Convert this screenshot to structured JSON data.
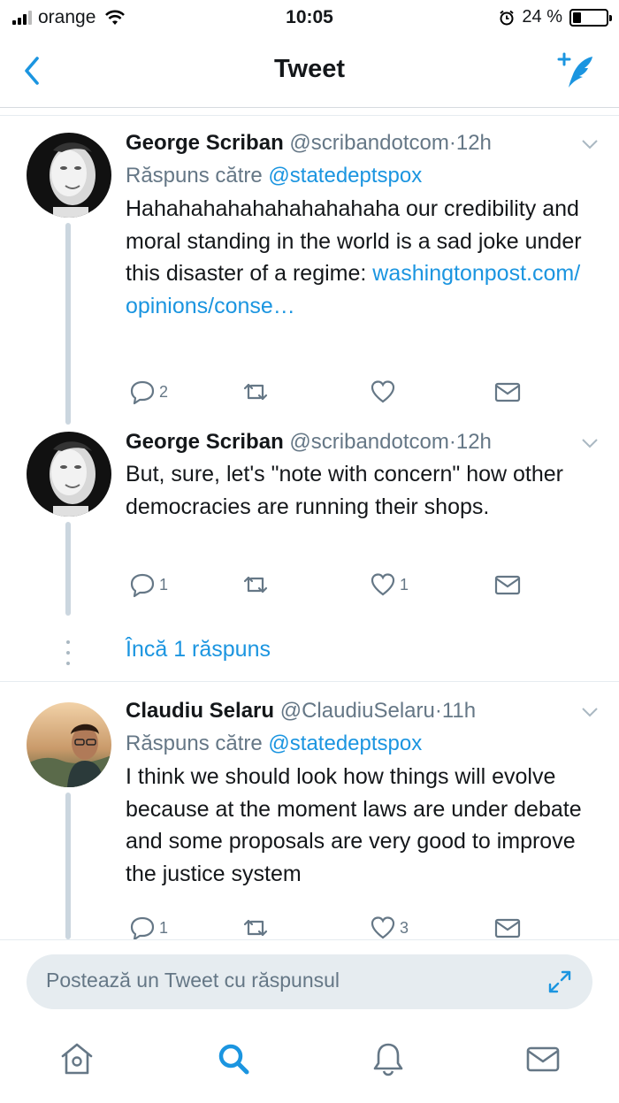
{
  "status_bar": {
    "carrier": "orange",
    "time": "10:05",
    "battery_percent": "24 %",
    "battery_level": 0.24
  },
  "nav": {
    "title": "Tweet",
    "back_icon": "chevron-left-icon",
    "compose_icon": "compose-tweet-icon"
  },
  "tweets": [
    {
      "name": "George Scriban",
      "handle": "@scribandotcom",
      "dot": "·",
      "time": "12h",
      "reply_prefix": "Răspuns către",
      "reply_mention": "@statedeptspox",
      "text": "Hahahahahahahahahahaha our credibility and moral standing in the world is a sad joke under this disaster of a regime: ",
      "link": "washingtonpost.com/ opinions/conse…",
      "replies": "2",
      "retweets": "",
      "likes": "",
      "avatar_icon": "avatar-photo"
    },
    {
      "name": "George Scriban",
      "handle": "@scribandotcom",
      "dot": "·",
      "time": "12h",
      "text": "But, sure, let's \"note with concern\" how other democracies are running their shops.",
      "replies": "1",
      "retweets": "",
      "likes": "1",
      "avatar_icon": "avatar-photo"
    },
    {
      "name": "Claudiu Selaru",
      "handle": "@ClaudiuSelaru",
      "dot": "·",
      "time": "11h",
      "reply_prefix": "Răspuns către",
      "reply_mention": "@statedeptspox",
      "text": "I think we should look how things will evolve because at the moment laws are under debate and some proposals are very good to improve the justice system",
      "replies": "1",
      "retweets": "",
      "likes": "3",
      "avatar_icon": "avatar-photo"
    }
  ],
  "more_replies": "Încă 1 răspuns",
  "reply_bar": {
    "placeholder": "Postează un Tweet cu răspunsul"
  },
  "tabs": [
    "home-icon",
    "search-icon",
    "notifications-icon",
    "messages-icon"
  ],
  "colors": {
    "accent": "#1b95e0",
    "muted": "#657786",
    "thread_line": "#cbd6df"
  }
}
